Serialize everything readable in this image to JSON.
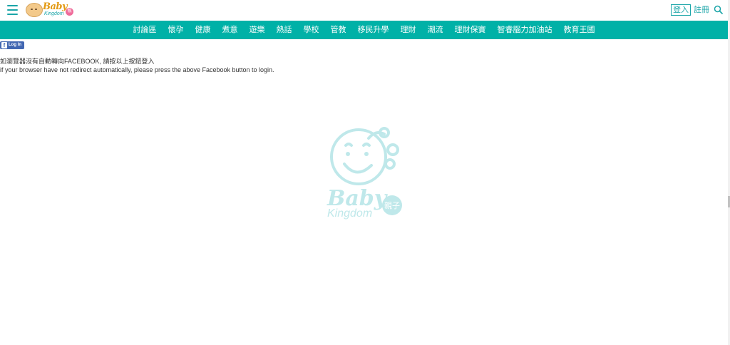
{
  "header": {
    "logo": {
      "baby": "Baby",
      "kingdom": "Kingdom",
      "badge": "親子"
    },
    "login_label": "登入",
    "register_label": "註冊"
  },
  "nav": {
    "items": [
      "討論區",
      "懷孕",
      "健康",
      "煮意",
      "遊樂",
      "熱話",
      "學校",
      "管教",
      "移民升學",
      "理財",
      "潮流",
      "理財保實",
      "智睿腦力加油站",
      "教育王國"
    ]
  },
  "facebook": {
    "login_label": "Log In"
  },
  "message": {
    "zh": "如瀏覽器沒有自動轉向FACEBOOK, 請按以上按鈕登入",
    "en": "if your browser have not redirect automatically, please press the above Facebook button to login."
  },
  "watermark": {
    "baby": "Baby",
    "kingdom": "Kingdom",
    "badge": "親子"
  },
  "colors": {
    "accent": "#00b1a7",
    "fb": "#4267b2",
    "watermark": "#bfe8ea"
  }
}
